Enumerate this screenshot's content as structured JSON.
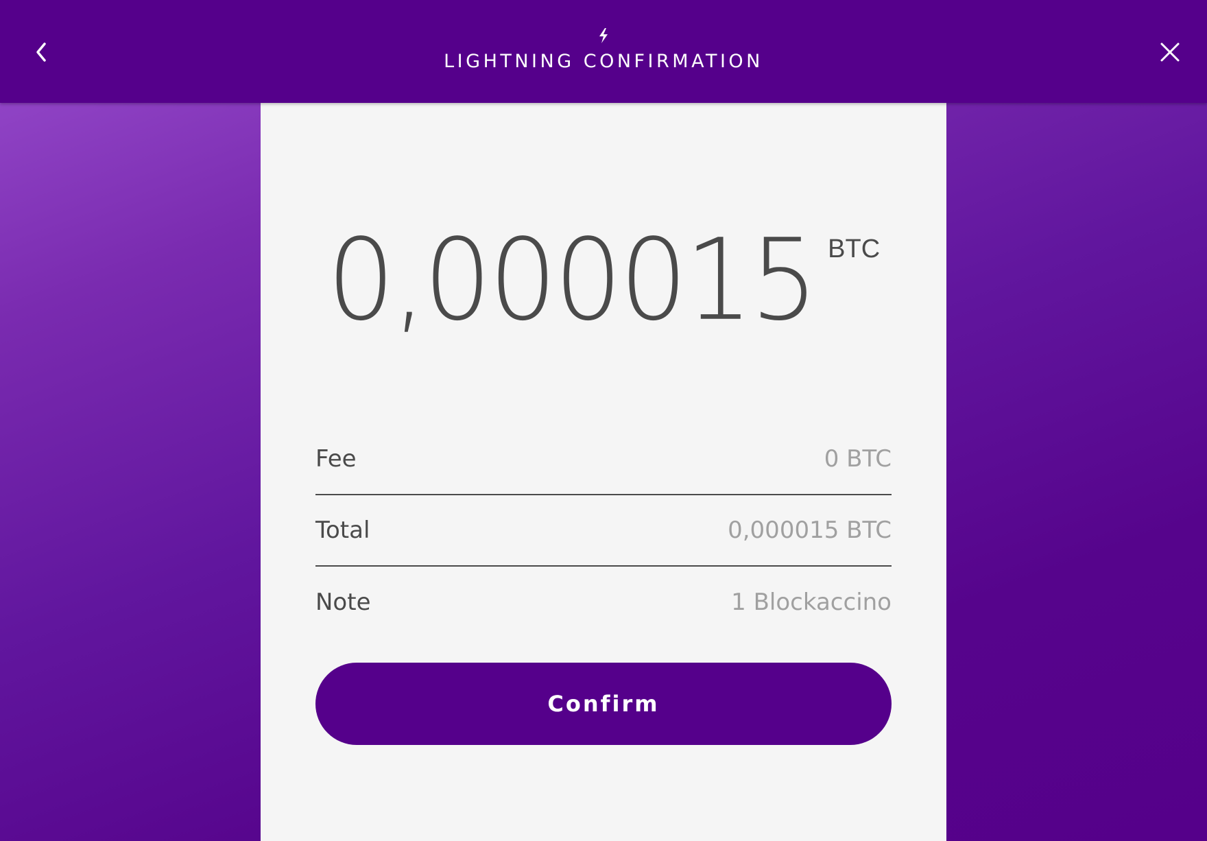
{
  "header": {
    "title": "LIGHTNING CONFIRMATION",
    "back_icon": "chevron-left-icon",
    "close_icon": "close-icon",
    "title_icon": "lightning-bolt-icon"
  },
  "payment": {
    "amount": "0,000015",
    "unit": "BTC"
  },
  "details": [
    {
      "label": "Fee",
      "value": "0 BTC"
    },
    {
      "label": "Total",
      "value": "0,000015 BTC"
    },
    {
      "label": "Note",
      "value": "1 Blockaccino"
    }
  ],
  "actions": {
    "confirm_label": "Confirm"
  },
  "colors": {
    "brand_purple": "#55008b",
    "card_bg": "#f5f5f5",
    "text_dark": "#4a4a4a",
    "text_muted": "#a0a0a0"
  }
}
